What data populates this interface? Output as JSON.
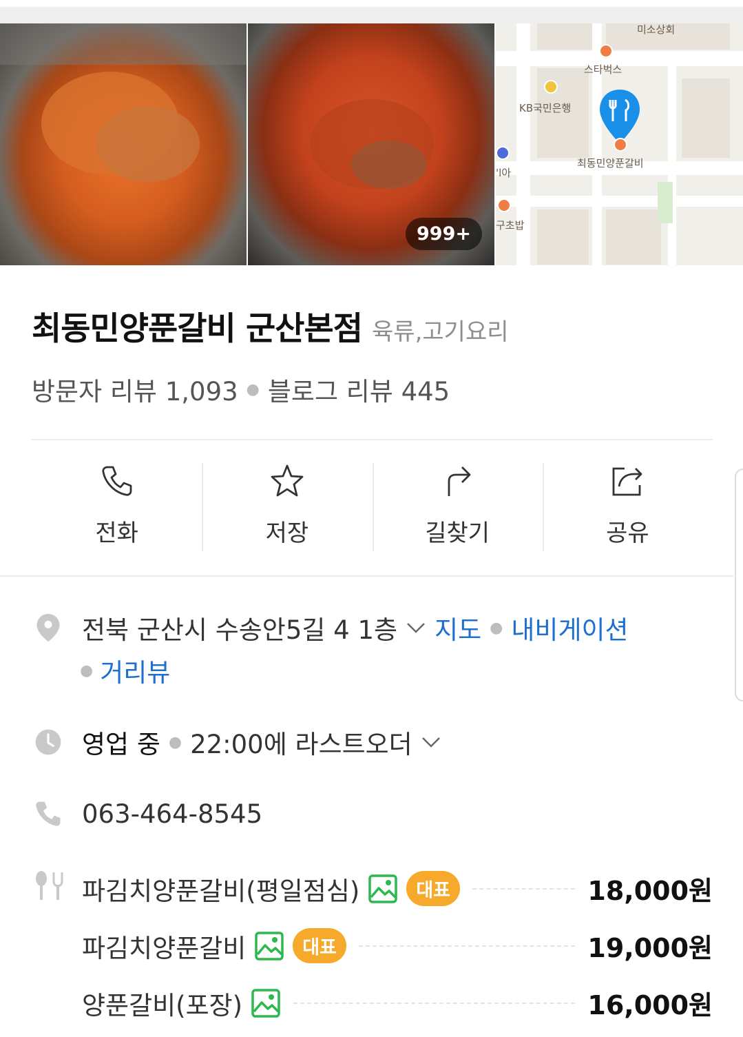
{
  "gallery": {
    "photo_count_badge": "999+",
    "map_labels": {
      "top": "미소상회",
      "starbucks": "스타벅스",
      "kb": "KB국민은행",
      "restaurant": "최동민양푼갈비",
      "left_mid": "'l아",
      "left_bottom": "구초밥"
    }
  },
  "place": {
    "name": "최동민양푼갈비 군산본점",
    "category": "육류,고기요리",
    "visitor_reviews": "방문자 리뷰 1,093",
    "blog_reviews": "블로그 리뷰 445"
  },
  "actions": [
    {
      "label": "전화",
      "icon": "phone-icon"
    },
    {
      "label": "저장",
      "icon": "star-icon"
    },
    {
      "label": "길찾기",
      "icon": "directions-icon"
    },
    {
      "label": "공유",
      "icon": "share-icon"
    }
  ],
  "info": {
    "address": "전북 군산시 수송안5길 4 1층",
    "map_link": "지도",
    "navi_link": "내비게이션",
    "streetview_link": "거리뷰",
    "status": "영업 중",
    "last_order": "22:00에 라스트오더",
    "phone": "063-464-8545"
  },
  "menu": [
    {
      "name": "파김치양푼갈비(평일점심)",
      "badge": "대표",
      "price": "18,000원"
    },
    {
      "name": "파김치양푼갈비",
      "badge": "대표",
      "price": "19,000원"
    },
    {
      "name": "양푼갈비(포장)",
      "badge": "",
      "price": "16,000원"
    }
  ],
  "colors": {
    "link": "#1f6fd0",
    "badge": "#f6a92a",
    "pin": "#1a8fe8",
    "image_icon": "#2db84d"
  }
}
